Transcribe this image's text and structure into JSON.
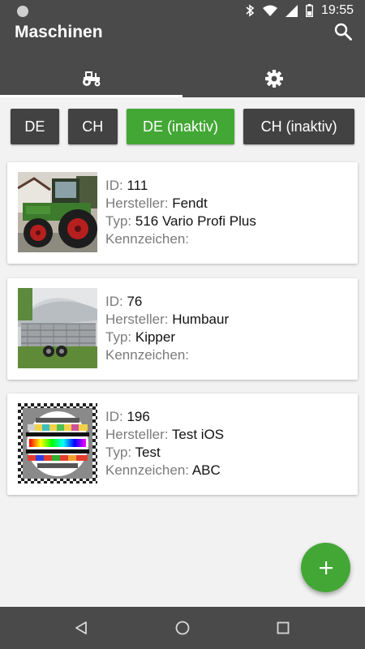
{
  "status_bar": {
    "time": "19:55",
    "icons": [
      "notification-dot-icon",
      "bluetooth-icon",
      "wifi-icon",
      "signal-icon",
      "battery-icon"
    ]
  },
  "app_bar": {
    "title": "Maschinen",
    "search_icon": "search-icon",
    "tabs": [
      {
        "icon": "tractor-icon",
        "selected": true
      },
      {
        "icon": "gear-icon",
        "selected": false
      }
    ]
  },
  "filters": [
    {
      "label": "DE",
      "active": false
    },
    {
      "label": "CH",
      "active": false
    },
    {
      "label": "DE (inaktiv)",
      "active": true
    },
    {
      "label": "CH (inaktiv)",
      "active": false
    }
  ],
  "labels": {
    "id": "ID:",
    "manufacturer": "Hersteller:",
    "type": "Typ:",
    "plate": "Kennzeichen:"
  },
  "machines": [
    {
      "id": "111",
      "manufacturer": "Fendt",
      "type": "516 Vario Profi Plus",
      "plate": "",
      "image": "tractor-photo"
    },
    {
      "id": "76",
      "manufacturer": "Humbaur",
      "type": "Kipper",
      "plate": "",
      "image": "trailer-photo"
    },
    {
      "id": "196",
      "manufacturer": "Test iOS",
      "type": "Test",
      "plate": "ABC",
      "image": "test-pattern"
    }
  ],
  "fab": {
    "icon": "plus-icon"
  },
  "nav_bar": {
    "icons": [
      "back-icon",
      "home-icon",
      "recents-icon"
    ]
  },
  "colors": {
    "accent": "#43a735",
    "app_bar": "#4a4a4a",
    "filter_inactive": "#424242",
    "background": "#f2f2f2"
  }
}
